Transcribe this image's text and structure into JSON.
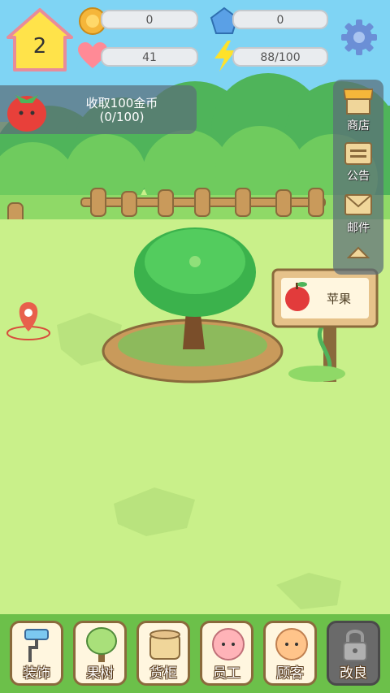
{
  "level": "2",
  "stats": {
    "coins": "0",
    "gems": "0",
    "hearts": "41",
    "energy": "88/100"
  },
  "quest": {
    "line1": "收取100金币",
    "line2": "(0/100)"
  },
  "side_menu": {
    "shop": "商店",
    "notice": "公告",
    "mail": "邮件"
  },
  "tree_sign": {
    "fruit": "苹果"
  },
  "tabs": {
    "decor": "装饰",
    "fruit_tree": "果树",
    "shelf": "货柜",
    "staff": "员工",
    "customer": "顾客",
    "upgrade": "改良"
  },
  "colors": {
    "grass": "#c9f08a",
    "sky": "#7fd4f4",
    "panel": "#5a6e78",
    "tab_bg": "#fff6df",
    "tab_border": "#8a6a3c"
  }
}
